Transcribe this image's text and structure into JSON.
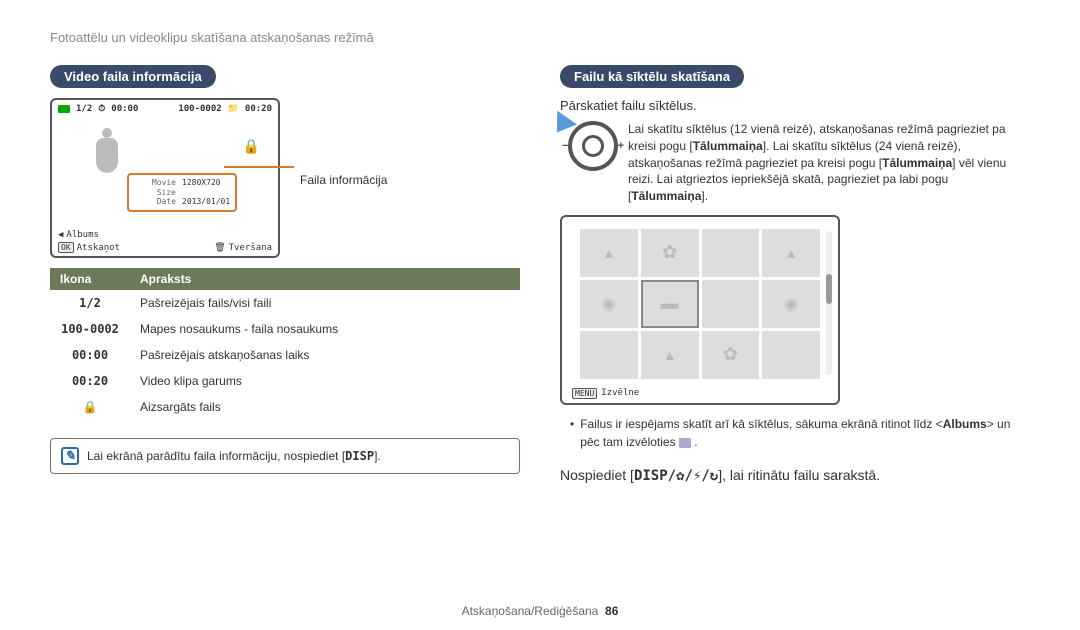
{
  "header": "Fotoattēlu un videoklipu skatīšana atskaņošanas režīmā",
  "left": {
    "section_title": "Video faila informācija",
    "screen": {
      "file_index": "1/2",
      "time_current": "00:00",
      "folder_file": "100-0002",
      "time_total": "00:20",
      "popup": {
        "movie_size_label": "Movie Size",
        "movie_size_value": "1280X720",
        "date_label": "Date",
        "date_value": "2013/01/01"
      },
      "albums_label": "Albums",
      "ok_label": "OK",
      "play_label": "Atskaņot",
      "capture_label": "Tveršana"
    },
    "info_callout": "Faila informācija",
    "table": {
      "col_icon": "Ikona",
      "col_desc": "Apraksts",
      "rows": [
        {
          "icon": "1/2",
          "desc": "Pašreizējais fails/visi faili"
        },
        {
          "icon": "100-0002",
          "desc": "Mapes nosaukums - faila nosaukums"
        },
        {
          "icon": "00:00",
          "desc": "Pašreizējais atskaņošanas laiks"
        },
        {
          "icon": "00:20",
          "desc": "Video klipa garums"
        },
        {
          "icon": "🔒",
          "desc": "Aizsargāts fails"
        }
      ]
    },
    "note": {
      "text_pre": "Lai ekrānā parādītu faila informāciju, nospiediet [",
      "disp": "DISP",
      "text_post": "]."
    }
  },
  "right": {
    "section_title": "Failu kā sīktēlu skatīšana",
    "intro": "Pārskatiet failu sīktēlus.",
    "dial_text_parts": {
      "p1": "Lai skatītu sīktēlus (12 vienā reizē), atskaņošanas režīmā pagrieziet pa kreisi pogu [",
      "b1": "Tālummaiņa",
      "p2": "]. Lai skatītu sīktēlus (24 vienā reizē), atskaņošanas režīmā pagrieziet pa kreisi pogu [",
      "b2": "Tālummaiņa",
      "p3": "] vēl vienu reizi. Lai atgrieztos iepriekšējā skatā, pagrieziet pa labi pogu [",
      "b3": "Tālummaiņa",
      "p4": "]."
    },
    "thumb_bottom": {
      "menu_key": "MENU",
      "menu_label": "Izvēlne"
    },
    "bullet": {
      "pre": "Failus ir iespējams skatīt arī kā sīktēlus, sākuma ekrānā ritinot līdz <",
      "b": "Albums",
      "post": "> un pēc tam izvēloties "
    },
    "final": {
      "pre": "Nospiediet [",
      "icons": "DISP/✿/⚡/↻",
      "post": "], lai ritinātu failu sarakstā."
    }
  },
  "footer": {
    "label": "Atskaņošana/Rediģēšana",
    "page": "86"
  }
}
